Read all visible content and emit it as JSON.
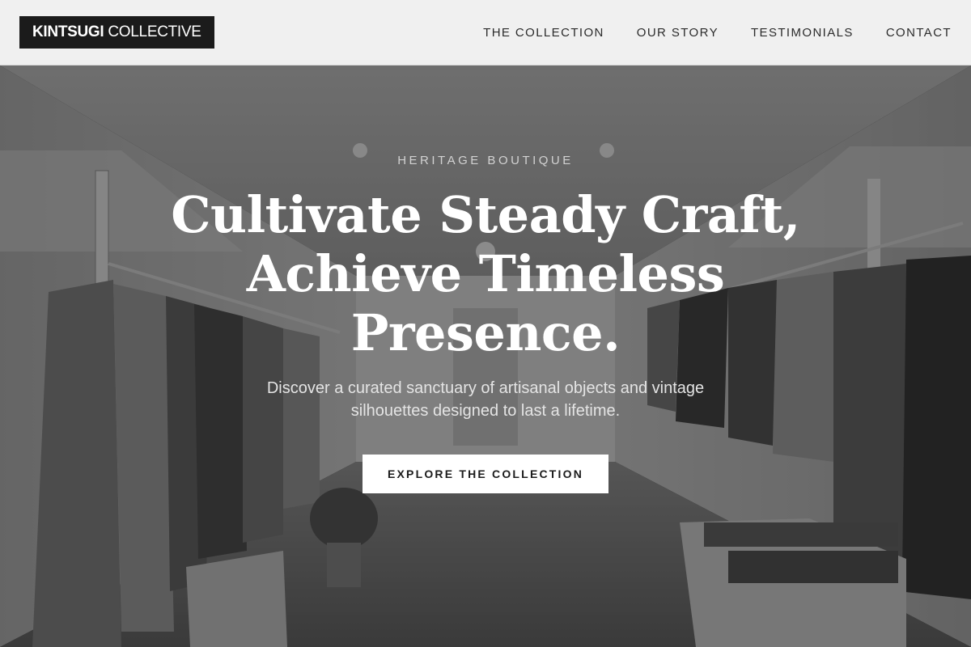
{
  "header": {
    "logo_bold": "KINTSUGI",
    "logo_light": "COLLECTIVE",
    "nav": [
      {
        "label": "THE COLLECTION"
      },
      {
        "label": "OUR STORY"
      },
      {
        "label": "TESTIMONIALS"
      },
      {
        "label": "CONTACT"
      }
    ]
  },
  "hero": {
    "eyebrow": "HERITAGE BOUTIQUE",
    "headline_lines": [
      "Cultivate Steady Craft,",
      "Achieve Timeless",
      "Presence."
    ],
    "subtext_lines": [
      "Discover a curated sanctuary of artisanal objects and vintage",
      "silhouettes designed to last a lifetime."
    ],
    "cta_label": "EXPLORE THE COLLECTION",
    "background_image": "boutique-interior-photo"
  },
  "colors": {
    "header_bg": "#f0f0f0",
    "logo_bg": "#1b1b1b",
    "nav_text": "#2b2b2b",
    "hero_text": "#ffffff",
    "cta_bg": "#ffffff",
    "cta_text": "#1c1c1c"
  }
}
